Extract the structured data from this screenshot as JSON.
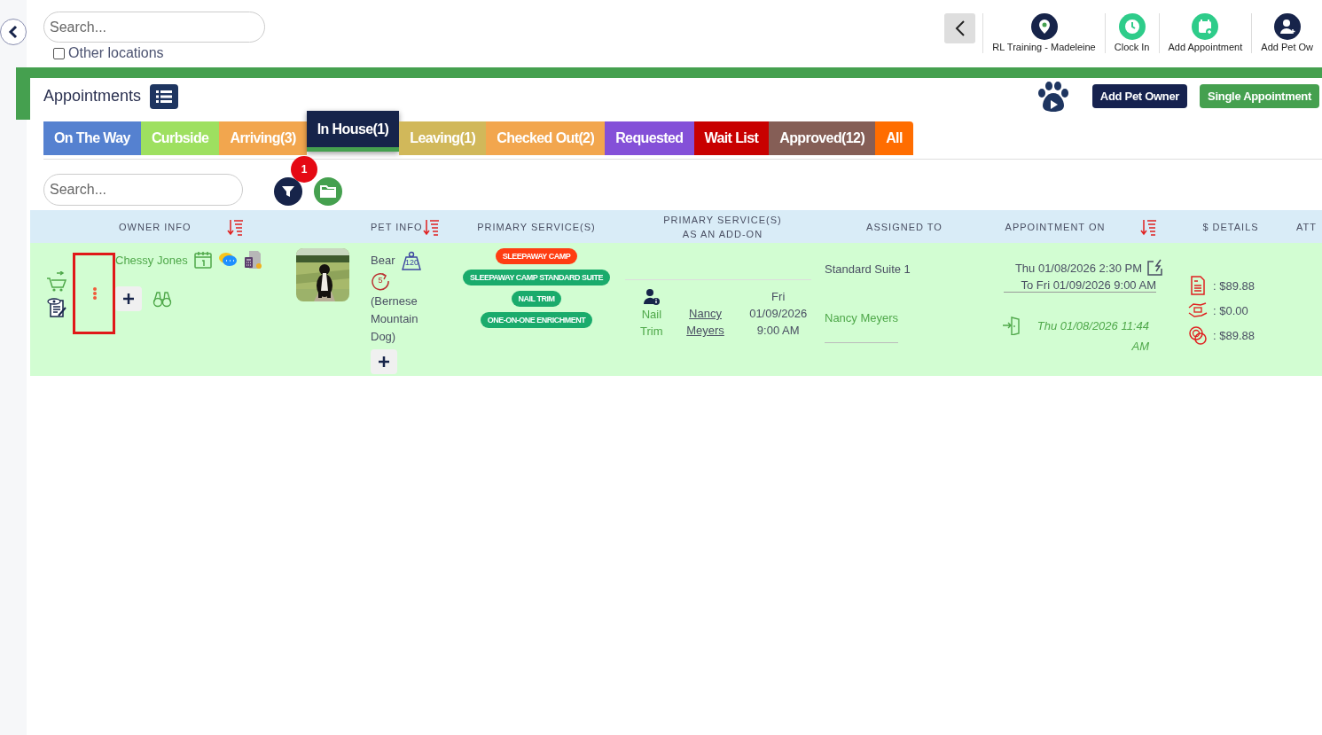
{
  "search": {
    "placeholder": "Search..."
  },
  "other_locations": {
    "label": "Other locations",
    "checked": false
  },
  "toolbar": [
    {
      "kind": "location",
      "label": "RL Training - Madeleine"
    },
    {
      "kind": "clock",
      "label": "Clock In"
    },
    {
      "kind": "calendar",
      "label": "Add Appointment"
    },
    {
      "kind": "person",
      "label": "Add Pet Ow"
    }
  ],
  "page_title": "Appointments",
  "header_buttons": [
    {
      "kind": "primary",
      "label": "Add Pet Owner"
    },
    {
      "kind": "success",
      "label": "Single Appointment"
    }
  ],
  "tabs": [
    {
      "label": "On The Way",
      "color": "#5581d0",
      "selected": false
    },
    {
      "label": "Curbside",
      "color": "#9ee060",
      "selected": false
    },
    {
      "label": "Arriving(3)",
      "color": "#f2a64e",
      "selected": false
    },
    {
      "label": "In House(1)",
      "color": "#16244a",
      "selected": true
    },
    {
      "label": "Leaving(1)",
      "color": "#d1b85a",
      "selected": false
    },
    {
      "label": "Checked Out(2)",
      "color": "#f2a64e",
      "selected": false
    },
    {
      "label": "Requested",
      "color": "#8450d8",
      "selected": false
    },
    {
      "label": "Wait List",
      "color": "#c80000",
      "selected": false
    },
    {
      "label": "Approved(12)",
      "color": "#855e56",
      "selected": false
    },
    {
      "label": "All",
      "color": "#ff6d00",
      "selected": false
    }
  ],
  "list_search": {
    "placeholder": "Search..."
  },
  "filter_count": "1",
  "table": {
    "columns": [
      {
        "label": "OWNER INFO",
        "sortable": true
      },
      {
        "label": "PET INFO",
        "sortable": true
      },
      {
        "label": "PRIMARY SERVICE(S)",
        "sortable": false
      },
      {
        "label": "PRIMARY SERVICE(S)\nAS AN ADD-ON",
        "sortable": false
      },
      {
        "label": "ASSIGNED TO",
        "sortable": false
      },
      {
        "label": "APPOINTMENT ON",
        "sortable": true
      },
      {
        "label": "$ DETAILS",
        "sortable": false
      },
      {
        "label": "ATT",
        "sortable": false
      }
    ],
    "rows": [
      {
        "menu_highlighted": true,
        "owner": "Chessy Jones",
        "pet": {
          "name": "Bear",
          "weight": "120",
          "visits": "5",
          "breed": "(Bernese Mountain Dog)"
        },
        "services": [
          {
            "label": "SLEEPAWAY CAMP",
            "color": "#ff3d12"
          },
          {
            "label": "SLEEPAWAY CAMP STANDARD SUITE",
            "color": "#1aab6c"
          },
          {
            "label": "NAIL TRIM",
            "color": "#1aab6c"
          },
          {
            "label": "ONE-ON-ONE ENRICHMENT",
            "color": "#1aab6c"
          }
        ],
        "addon": {
          "service": "Nail Trim",
          "staff": "Nancy Meyers",
          "date": "Fri 01/09/2026 9:00 AM"
        },
        "assigned": [
          {
            "kind": "suite",
            "label": "Standard Suite 1"
          },
          {
            "kind": "staff",
            "label": "Nancy Meyers"
          }
        ],
        "appointment": {
          "start": "Thu 01/08/2026 2:30 PM",
          "end": "To Fri 01/09/2026 9:00 AM",
          "checked_in": "Thu 01/08/2026 11:44 AM"
        },
        "details": [
          {
            "kind": "invoice",
            "amount": ": $89.88"
          },
          {
            "kind": "discount",
            "amount": ": $0.00"
          },
          {
            "kind": "paid",
            "amount": ": $89.88"
          }
        ]
      }
    ]
  }
}
